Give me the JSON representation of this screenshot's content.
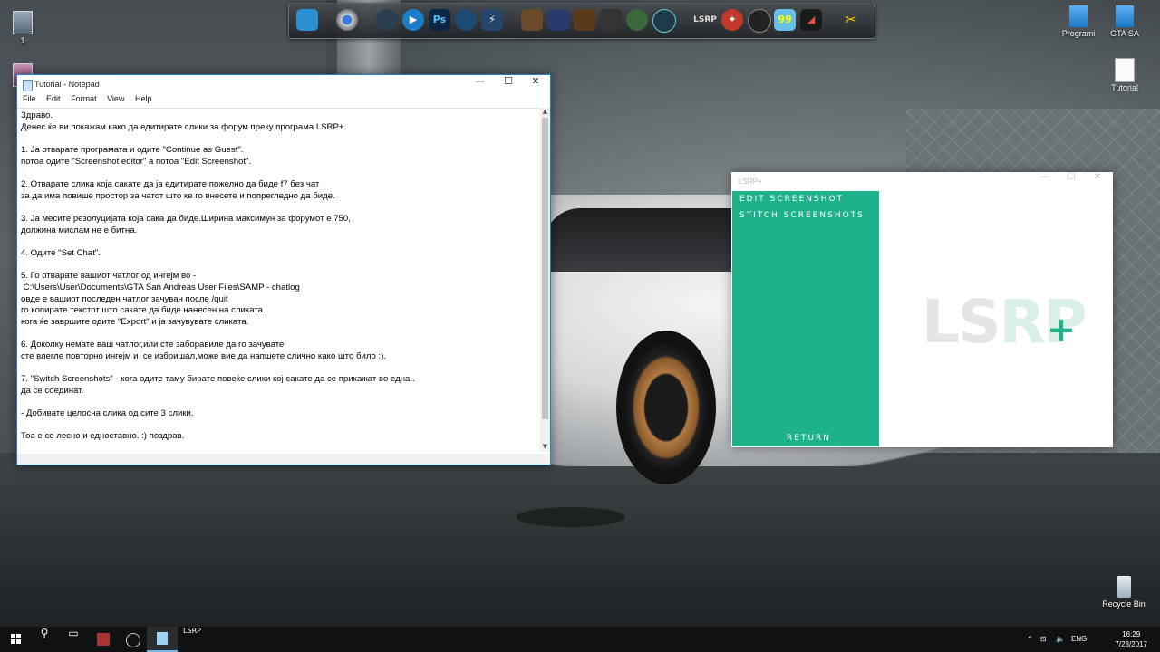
{
  "desktop": {
    "left_icon_label": "1",
    "icons": [
      {
        "label": "Programi"
      },
      {
        "label": "GTA SA"
      },
      {
        "label": "Tutorial"
      },
      {
        "label": "Recycle Bin"
      }
    ]
  },
  "dock": {
    "badge_text": "LSRP",
    "counter_text": "99"
  },
  "notepad": {
    "title": "Tutorial - Notepad",
    "menu": [
      "File",
      "Edit",
      "Format",
      "View",
      "Help"
    ],
    "controls": {
      "minimize": "—",
      "maximize": "☐",
      "close": "✕"
    },
    "content": "Здраво.\nДенес ќе ви покажам како да едитирате слики за форум преку програма LSRP+.\n\n1. Ја отварате програмата и одите \"Continue as Guest\".\nпотоа одите \"Screenshot editor\" а потоа \"Edit Screenshot\".\n\n2. Отварате слика која сакате да ја едитирате пожелно да биде f7 без чат\nза да има повише простор за чатот што ке го внесете и попрегледно да биде.\n\n3. Ја месите резолуцијата која сака да биде.Ширина максимун за форумот е 750,\nдолжина мислам не е битна.\n\n4. Одите \"Set Chat\".\n\n5. Го отварате вашиот чатлог од ингејм во -\n C:\\Users\\User\\Documents\\GTA San Andreas User Files\\SAMP - chatlog\nовде е вашиот последен чатлог зачуван после /quit\nго копирате текстот што сакате да биде нанесен на сликата.\nкога ќе завршите одите \"Export\" и ја зачувувате сликата.\n\n6. Доколку немате ваш чатлог,или сте заборавиле да го зачувате\nсте влегле повторно ингејм и  се избришал,може вие да напшете слично како што било :).\n\n7. \"Switch Screenshots\" - кога одите таму бирате повеќе слики кој сакате да се прикажат во една..\nда се соединат.\n\n- Добивате целосна слика од сите 3 слики.\n\nТоа е се лесно и едноставно. :) поздрав."
  },
  "lsrp_app": {
    "title": "LSRP+",
    "controls": {
      "minimize": "—",
      "maximize": "☐",
      "close": "✕"
    },
    "menu": {
      "edit": "EDIT SCREENSHOT",
      "stitch": "STITCH SCREENSHOTS",
      "return": "RETURN"
    },
    "logo_text": "LS",
    "logo_rp": "RP",
    "logo_plus": "+",
    "accent_color": "#1eb28a"
  },
  "taskbar": {
    "active_app_label": "LSRP",
    "language": "ENG",
    "time": "16:29",
    "date": "7/23/2017"
  }
}
